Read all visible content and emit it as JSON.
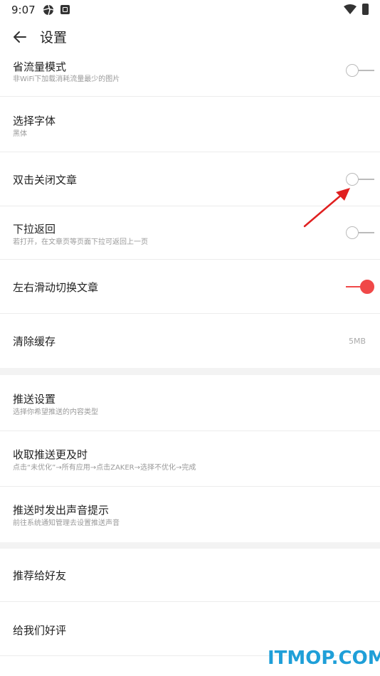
{
  "status": {
    "time": "9:07"
  },
  "header": {
    "title": "设置"
  },
  "settings": [
    {
      "title": "省流量模式",
      "subtitle": "非WiFi下加载消耗流量最少的图片",
      "switch_on": false
    },
    {
      "title": "选择字体",
      "subtitle": "黑体"
    },
    {
      "title": "双击关闭文章",
      "switch_on": false
    },
    {
      "title": "下拉返回",
      "subtitle": "若打开，在文章页等页面下拉可返回上一页",
      "switch_on": false
    },
    {
      "title": "左右滑动切换文章",
      "switch_on": true
    },
    {
      "title": "清除缓存",
      "value": "5MB"
    }
  ],
  "push": [
    {
      "title": "推送设置",
      "subtitle": "选择你希望推送的内容类型"
    },
    {
      "title": "收取推送更及时",
      "subtitle": "点击“未优化”→所有应用→点击ZAKER→选择不优化→完成"
    },
    {
      "title": "推送时发出声音提示",
      "subtitle": "前往系统通知管理去设置推送声音"
    }
  ],
  "share": [
    {
      "title": "推荐给好友"
    },
    {
      "title": "给我们好评"
    }
  ],
  "colors": {
    "accent": "#f04848",
    "watermark": "#1f9fd8"
  },
  "watermark": "ITMOP.COM"
}
